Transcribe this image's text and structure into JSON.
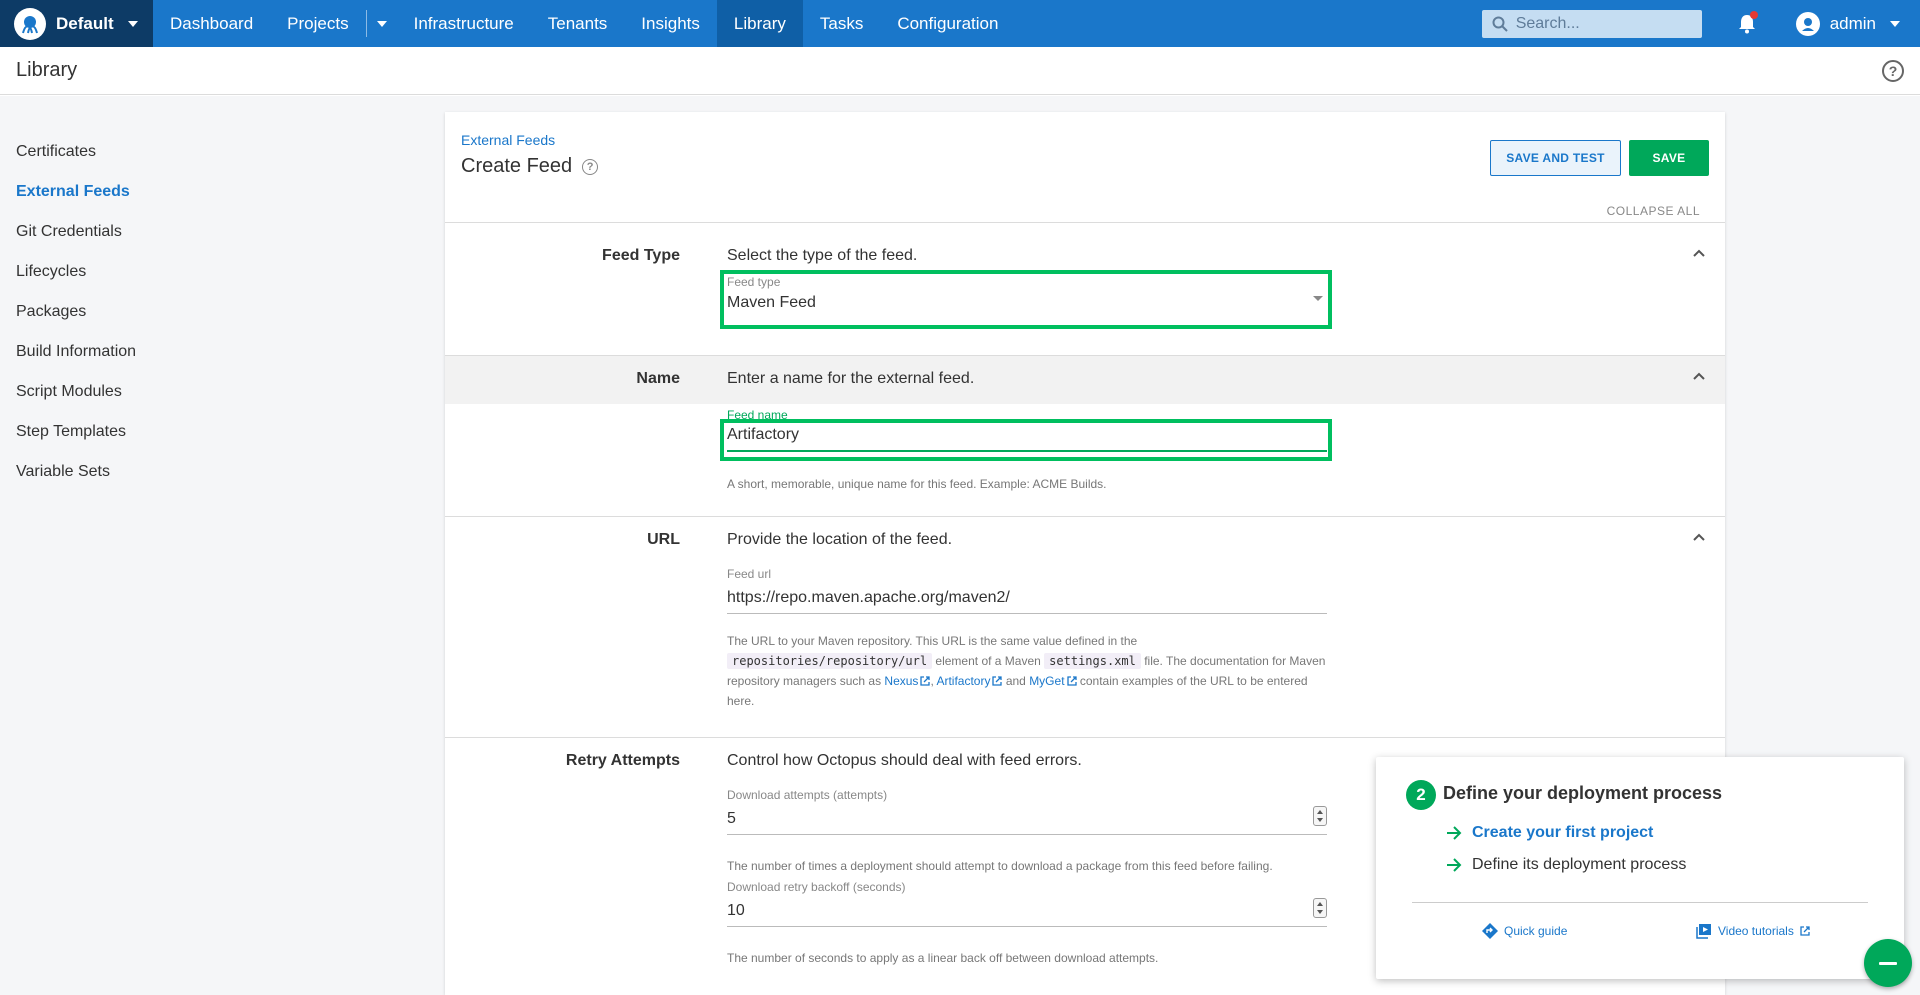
{
  "colors": {
    "nav_bg": "#1a77ca",
    "nav_active": "#0f5fa6",
    "space_bg": "#0d3b66",
    "primary_green": "#00a85a",
    "highlight": "#00bf5f",
    "link": "#1a77ca"
  },
  "topnav": {
    "space": "Default",
    "items": [
      "Dashboard",
      "Projects",
      "Infrastructure",
      "Tenants",
      "Insights",
      "Library",
      "Tasks",
      "Configuration"
    ],
    "active": "Library",
    "search_placeholder": "Search...",
    "user": "admin"
  },
  "page": {
    "title": "Library"
  },
  "sidebar": {
    "items": [
      "Certificates",
      "External Feeds",
      "Git Credentials",
      "Lifecycles",
      "Packages",
      "Build Information",
      "Script Modules",
      "Step Templates",
      "Variable Sets"
    ],
    "active": "External Feeds"
  },
  "form": {
    "breadcrumb": "External Feeds",
    "title": "Create Feed",
    "save_and_test": "SAVE AND TEST",
    "save": "SAVE",
    "collapse_all": "COLLAPSE ALL",
    "feed_type": {
      "label": "Feed Type",
      "description": "Select the type of the feed.",
      "field_label": "Feed type",
      "value": "Maven Feed"
    },
    "name": {
      "label": "Name",
      "description": "Enter a name for the external feed.",
      "field_label": "Feed name",
      "value": "Artifactory",
      "help": "A short, memorable, unique name for this feed. Example: ACME Builds."
    },
    "url": {
      "label": "URL",
      "description": "Provide the location of the feed.",
      "field_label": "Feed url",
      "value": "https://repo.maven.apache.org/maven2/",
      "help_1": "The URL to your Maven repository. This URL is the same value defined in the",
      "code_1": "repositories/repository/url",
      "help_2": "element of a Maven",
      "code_2": "settings.xml",
      "help_3": "file. The documentation for Maven repository managers such as",
      "link_nexus": "Nexus",
      "link_artifactory": "Artifactory",
      "help_and": "and",
      "link_myget": "MyGet",
      "help_4": "contain examples of the URL to be entered here."
    },
    "retry": {
      "label": "Retry Attempts",
      "description": "Control how Octopus should deal with feed errors.",
      "attempts_label": "Download attempts (attempts)",
      "attempts_value": "5",
      "attempts_help": "The number of times a deployment should attempt to download a package from this feed before failing.",
      "backoff_label": "Download retry backoff (seconds)",
      "backoff_value": "10",
      "backoff_help": "The number of seconds to apply as a linear back off between download attempts."
    }
  },
  "onboarding": {
    "step": "2",
    "title": "Define your deployment process",
    "item_1": "Create your first project",
    "item_2": "Define its deployment process",
    "quick_guide": "Quick guide",
    "video_tutorials": "Video tutorials"
  }
}
